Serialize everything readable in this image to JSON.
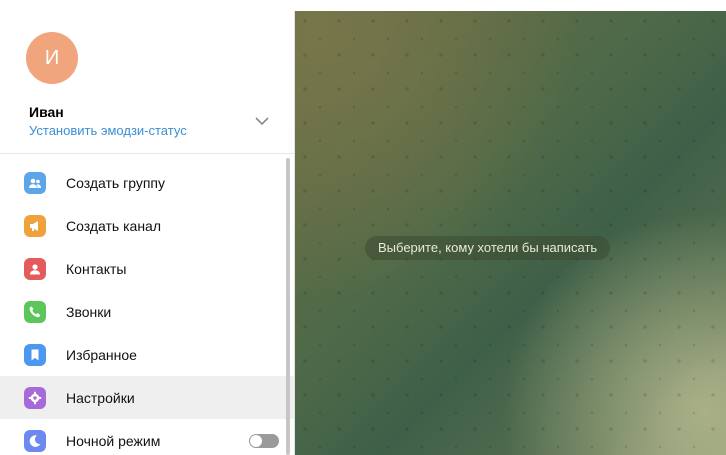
{
  "profile": {
    "avatar_initial": "И",
    "name": "Иван",
    "status_link": "Установить эмодзи-статус"
  },
  "menu": [
    {
      "label": "Создать группу",
      "icon": "group-icon",
      "color": "#5aa6e8"
    },
    {
      "label": "Создать канал",
      "icon": "megaphone-icon",
      "color": "#efa23c"
    },
    {
      "label": "Контакты",
      "icon": "contact-icon",
      "color": "#e35b5b"
    },
    {
      "label": "Звонки",
      "icon": "phone-icon",
      "color": "#5cc65a"
    },
    {
      "label": "Избранное",
      "icon": "bookmark-icon",
      "color": "#4c97f0"
    },
    {
      "label": "Настройки",
      "icon": "gear-icon",
      "color": "#a66bd8"
    },
    {
      "label": "Ночной режим",
      "icon": "moon-icon",
      "color": "#6d88ee"
    }
  ],
  "night_mode_enabled": false,
  "chat": {
    "empty_hint": "Выберите, кому хотели бы написать"
  },
  "colors": {
    "accent": "#3a8fd6",
    "avatar": "#f0a57d"
  }
}
